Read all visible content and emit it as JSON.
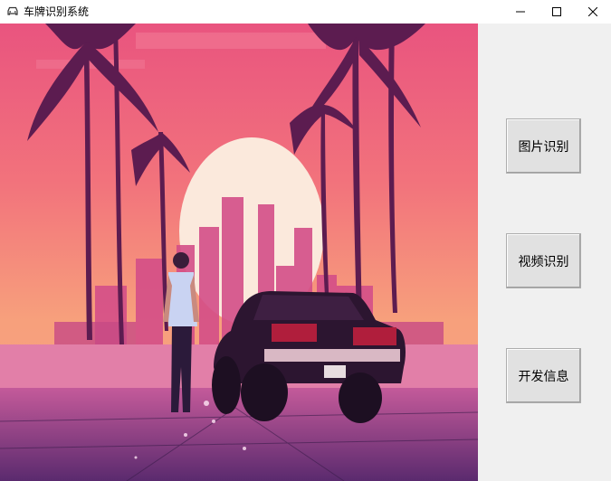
{
  "window": {
    "title": "车牌识别系统",
    "icon": "car-icon",
    "controls": [
      "minimize-icon",
      "maximize-icon",
      "close-icon"
    ]
  },
  "display": {
    "image": "synthwave-sunset-palm-trees-man-and-car"
  },
  "buttons": {
    "image_recognition": "图片识别",
    "video_recognition": "视频识别",
    "developer_info": "开发信息"
  },
  "colors": {
    "titlebar": "#ffffff",
    "panel": "#f0f0f0",
    "button_face": "#e1e1e1",
    "button_border": "#adadad"
  }
}
